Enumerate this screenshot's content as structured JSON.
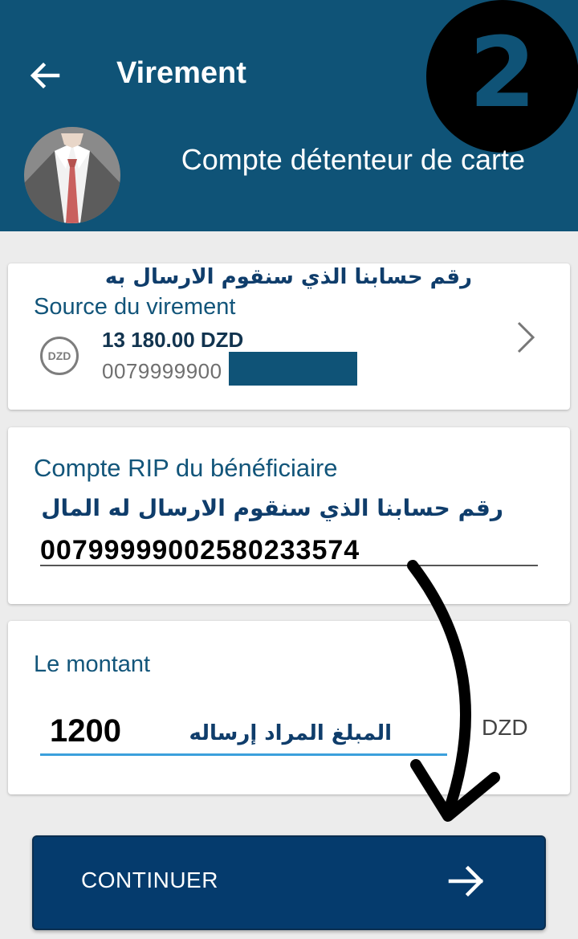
{
  "header": {
    "title": "Virement",
    "subtitle": "Compte détenteur de carte",
    "step_badge": "2",
    "back_icon": "arrow-left-icon",
    "bg_color": "#0f5377"
  },
  "source_card": {
    "annotation_ar": "رقم حسابنا الذي سنقوم الارسال به",
    "label": "Source du virement",
    "currency_icon_text": "DZD",
    "balance": "13 180.00 DZD",
    "account_number": "0079999900",
    "chevron_icon": "chevron-right-icon"
  },
  "beneficiary_card": {
    "label": "Compte RIP du bénéficiaire",
    "annotation_ar": "رقم حسابنا الذي سنقوم الارسال له المال",
    "rip_value": "00799999002580233574"
  },
  "amount_card": {
    "label": "Le montant",
    "amount_value": "1200",
    "annotation_ar": "المبلغ المراد إرساله",
    "currency": "DZD"
  },
  "continue_button": {
    "label": "CONTINUER",
    "icon": "arrow-right-icon",
    "bg_color": "#053b6d"
  }
}
